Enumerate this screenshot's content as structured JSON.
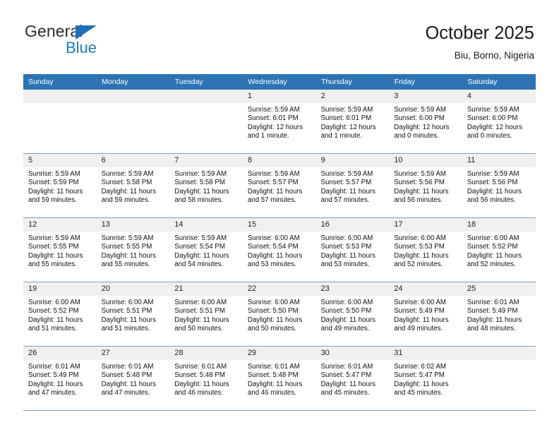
{
  "brand": {
    "name_top": "General",
    "name_bottom": "Blue",
    "triangle_color": "#1b72b8"
  },
  "header": {
    "title": "October 2025",
    "subtitle": "Biu, Borno, Nigeria"
  },
  "theme": {
    "header_blue": "#2e74b5",
    "daynum_band": "#f0f0f0",
    "grid_line": "#7ba0c4"
  },
  "weekdays": [
    "Sunday",
    "Monday",
    "Tuesday",
    "Wednesday",
    "Thursday",
    "Friday",
    "Saturday"
  ],
  "labels": {
    "sunrise_prefix": "Sunrise:",
    "sunset_prefix": "Sunset:",
    "daylight_prefix": "Daylight:"
  },
  "weeks": [
    [
      {
        "day": "",
        "empty": true
      },
      {
        "day": "",
        "empty": true
      },
      {
        "day": "",
        "empty": true
      },
      {
        "day": "1",
        "sunrise": "Sunrise: 5:59 AM",
        "sunset": "Sunset: 6:01 PM",
        "daylight1": "Daylight: 12 hours",
        "daylight2": "and 1 minute."
      },
      {
        "day": "2",
        "sunrise": "Sunrise: 5:59 AM",
        "sunset": "Sunset: 6:01 PM",
        "daylight1": "Daylight: 12 hours",
        "daylight2": "and 1 minute."
      },
      {
        "day": "3",
        "sunrise": "Sunrise: 5:59 AM",
        "sunset": "Sunset: 6:00 PM",
        "daylight1": "Daylight: 12 hours",
        "daylight2": "and 0 minutes."
      },
      {
        "day": "4",
        "sunrise": "Sunrise: 5:59 AM",
        "sunset": "Sunset: 6:00 PM",
        "daylight1": "Daylight: 12 hours",
        "daylight2": "and 0 minutes."
      }
    ],
    [
      {
        "day": "5",
        "sunrise": "Sunrise: 5:59 AM",
        "sunset": "Sunset: 5:59 PM",
        "daylight1": "Daylight: 11 hours",
        "daylight2": "and 59 minutes."
      },
      {
        "day": "6",
        "sunrise": "Sunrise: 5:59 AM",
        "sunset": "Sunset: 5:58 PM",
        "daylight1": "Daylight: 11 hours",
        "daylight2": "and 59 minutes."
      },
      {
        "day": "7",
        "sunrise": "Sunrise: 5:59 AM",
        "sunset": "Sunset: 5:58 PM",
        "daylight1": "Daylight: 11 hours",
        "daylight2": "and 58 minutes."
      },
      {
        "day": "8",
        "sunrise": "Sunrise: 5:59 AM",
        "sunset": "Sunset: 5:57 PM",
        "daylight1": "Daylight: 11 hours",
        "daylight2": "and 57 minutes."
      },
      {
        "day": "9",
        "sunrise": "Sunrise: 5:59 AM",
        "sunset": "Sunset: 5:57 PM",
        "daylight1": "Daylight: 11 hours",
        "daylight2": "and 57 minutes."
      },
      {
        "day": "10",
        "sunrise": "Sunrise: 5:59 AM",
        "sunset": "Sunset: 5:56 PM",
        "daylight1": "Daylight: 11 hours",
        "daylight2": "and 56 minutes."
      },
      {
        "day": "11",
        "sunrise": "Sunrise: 5:59 AM",
        "sunset": "Sunset: 5:56 PM",
        "daylight1": "Daylight: 11 hours",
        "daylight2": "and 56 minutes."
      }
    ],
    [
      {
        "day": "12",
        "sunrise": "Sunrise: 5:59 AM",
        "sunset": "Sunset: 5:55 PM",
        "daylight1": "Daylight: 11 hours",
        "daylight2": "and 55 minutes."
      },
      {
        "day": "13",
        "sunrise": "Sunrise: 5:59 AM",
        "sunset": "Sunset: 5:55 PM",
        "daylight1": "Daylight: 11 hours",
        "daylight2": "and 55 minutes."
      },
      {
        "day": "14",
        "sunrise": "Sunrise: 5:59 AM",
        "sunset": "Sunset: 5:54 PM",
        "daylight1": "Daylight: 11 hours",
        "daylight2": "and 54 minutes."
      },
      {
        "day": "15",
        "sunrise": "Sunrise: 6:00 AM",
        "sunset": "Sunset: 5:54 PM",
        "daylight1": "Daylight: 11 hours",
        "daylight2": "and 53 minutes."
      },
      {
        "day": "16",
        "sunrise": "Sunrise: 6:00 AM",
        "sunset": "Sunset: 5:53 PM",
        "daylight1": "Daylight: 11 hours",
        "daylight2": "and 53 minutes."
      },
      {
        "day": "17",
        "sunrise": "Sunrise: 6:00 AM",
        "sunset": "Sunset: 5:53 PM",
        "daylight1": "Daylight: 11 hours",
        "daylight2": "and 52 minutes."
      },
      {
        "day": "18",
        "sunrise": "Sunrise: 6:00 AM",
        "sunset": "Sunset: 5:52 PM",
        "daylight1": "Daylight: 11 hours",
        "daylight2": "and 52 minutes."
      }
    ],
    [
      {
        "day": "19",
        "sunrise": "Sunrise: 6:00 AM",
        "sunset": "Sunset: 5:52 PM",
        "daylight1": "Daylight: 11 hours",
        "daylight2": "and 51 minutes."
      },
      {
        "day": "20",
        "sunrise": "Sunrise: 6:00 AM",
        "sunset": "Sunset: 5:51 PM",
        "daylight1": "Daylight: 11 hours",
        "daylight2": "and 51 minutes."
      },
      {
        "day": "21",
        "sunrise": "Sunrise: 6:00 AM",
        "sunset": "Sunset: 5:51 PM",
        "daylight1": "Daylight: 11 hours",
        "daylight2": "and 50 minutes."
      },
      {
        "day": "22",
        "sunrise": "Sunrise: 6:00 AM",
        "sunset": "Sunset: 5:50 PM",
        "daylight1": "Daylight: 11 hours",
        "daylight2": "and 50 minutes."
      },
      {
        "day": "23",
        "sunrise": "Sunrise: 6:00 AM",
        "sunset": "Sunset: 5:50 PM",
        "daylight1": "Daylight: 11 hours",
        "daylight2": "and 49 minutes."
      },
      {
        "day": "24",
        "sunrise": "Sunrise: 6:00 AM",
        "sunset": "Sunset: 5:49 PM",
        "daylight1": "Daylight: 11 hours",
        "daylight2": "and 49 minutes."
      },
      {
        "day": "25",
        "sunrise": "Sunrise: 6:01 AM",
        "sunset": "Sunset: 5:49 PM",
        "daylight1": "Daylight: 11 hours",
        "daylight2": "and 48 minutes."
      }
    ],
    [
      {
        "day": "26",
        "sunrise": "Sunrise: 6:01 AM",
        "sunset": "Sunset: 5:49 PM",
        "daylight1": "Daylight: 11 hours",
        "daylight2": "and 47 minutes."
      },
      {
        "day": "27",
        "sunrise": "Sunrise: 6:01 AM",
        "sunset": "Sunset: 5:48 PM",
        "daylight1": "Daylight: 11 hours",
        "daylight2": "and 47 minutes."
      },
      {
        "day": "28",
        "sunrise": "Sunrise: 6:01 AM",
        "sunset": "Sunset: 5:48 PM",
        "daylight1": "Daylight: 11 hours",
        "daylight2": "and 46 minutes."
      },
      {
        "day": "29",
        "sunrise": "Sunrise: 6:01 AM",
        "sunset": "Sunset: 5:48 PM",
        "daylight1": "Daylight: 11 hours",
        "daylight2": "and 46 minutes."
      },
      {
        "day": "30",
        "sunrise": "Sunrise: 6:01 AM",
        "sunset": "Sunset: 5:47 PM",
        "daylight1": "Daylight: 11 hours",
        "daylight2": "and 45 minutes."
      },
      {
        "day": "31",
        "sunrise": "Sunrise: 6:02 AM",
        "sunset": "Sunset: 5:47 PM",
        "daylight1": "Daylight: 11 hours",
        "daylight2": "and 45 minutes."
      },
      {
        "day": "",
        "empty": true
      }
    ]
  ]
}
